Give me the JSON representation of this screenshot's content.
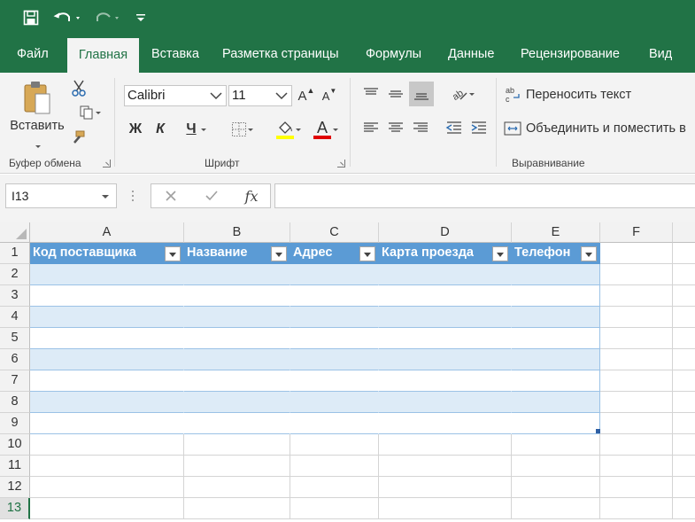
{
  "tabs": [
    "Файл",
    "Главная",
    "Вставка",
    "Разметка страницы",
    "Формулы",
    "Данные",
    "Рецензирование",
    "Вид"
  ],
  "clipboard": {
    "paste_label": "Вставить",
    "group_label": "Буфер обмена"
  },
  "font": {
    "name": "Calibri",
    "size": "11",
    "bold": "Ж",
    "italic": "К",
    "underline": "Ч",
    "font_color_letter": "A",
    "group_label": "Шрифт",
    "grow": "A",
    "shrink": "A"
  },
  "alignment": {
    "wrap_text": "Переносить текст",
    "merge_center": "Объединить и поместить в",
    "group_label": "Выравнивание"
  },
  "formula_bar": {
    "name_box": "I13",
    "fx": "fx"
  },
  "sheet": {
    "columns": [
      "A",
      "B",
      "C",
      "D",
      "E",
      "F"
    ],
    "rows": [
      "1",
      "2",
      "3",
      "4",
      "5",
      "6",
      "7",
      "8",
      "9",
      "10",
      "11",
      "12",
      "13"
    ],
    "table_headers": [
      "Код поставщика",
      "Название",
      "Адрес",
      "Карта проезда",
      "Телефон"
    ],
    "selected_row": "13"
  },
  "colors": {
    "accent": "#217346",
    "table_header": "#5b9bd5",
    "table_band": "#ddebf7"
  }
}
